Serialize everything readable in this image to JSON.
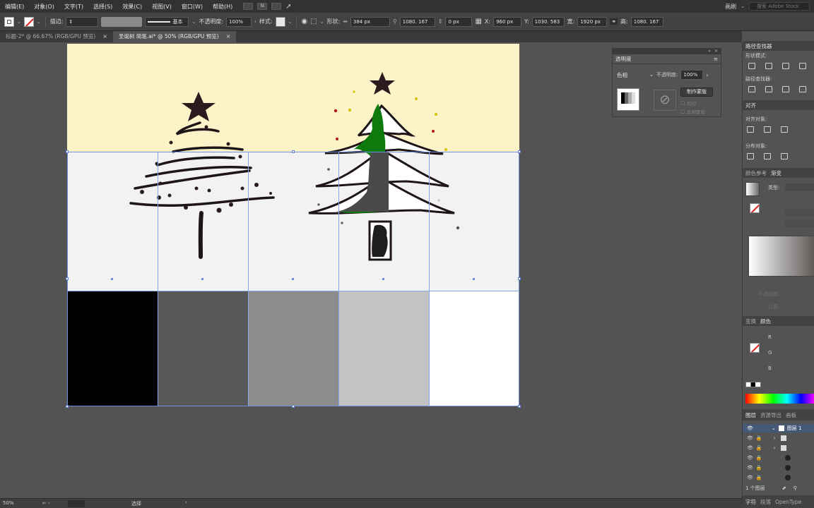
{
  "menu": {
    "items": [
      "编辑(E)",
      "对象(O)",
      "文字(T)",
      "选择(S)",
      "效果(C)",
      "视图(V)",
      "窗口(W)",
      "帮助(H)"
    ],
    "workspace": "画刷",
    "search_placeholder": "搜索 Adobe Stock"
  },
  "control": {
    "stroke_label": "描边:",
    "stroke_profile": "基本",
    "opacity_label": "不透明度:",
    "opacity_value": "100%",
    "style_label": "样式:",
    "shape_label": "形状:",
    "shape_w": "384 px",
    "shape_h": "1080. 167",
    "radius": "0 px",
    "x_label": "X:",
    "x_value": "960 px",
    "y_label": "Y:",
    "y_value": "1030. 583",
    "w_label": "宽:",
    "w_value": "1920 px",
    "h_label": "高:",
    "h_value": "1080. 167"
  },
  "tabs": [
    {
      "label": "标题-2* @ 66.67% (RGB/GPU 预览)",
      "active": false
    },
    {
      "label": "圣诞树 简笔.ai* @ 50% (RGB/GPU 预览)",
      "active": true
    }
  ],
  "transparency": {
    "title": "透明度",
    "blend_mode": "色相",
    "opacity_label": "不透明度:",
    "opacity_value": "100%",
    "make_mask": "制作蒙版",
    "clip": "剪切",
    "invert": "反相蒙版"
  },
  "dock": {
    "pathfinder_tab": "路径查找器",
    "shape_modes": "形状模式:",
    "pathfinders": "路径查找器:",
    "align_tab": "对齐",
    "align_objects": "对齐对象:",
    "distribute_objects": "分布对象:",
    "color_guide_tab": "颜色参考",
    "gradient_tab": "渐变",
    "type_label": "类型:",
    "opacity_lbl": "不透明度:",
    "location_lbl": "位置:",
    "transform_tab": "变换",
    "color_tab": "颜色",
    "r": "R",
    "g": "G",
    "b": "B",
    "layers_tab": "图层",
    "asset_export_tab": "资源导出",
    "artboards_tab": "画板",
    "layer_name": "图层 1",
    "layer_count": "1 个图层",
    "char_tab": "字符",
    "para_tab": "段落",
    "opentype_tab": "OpenType"
  },
  "statusbar": {
    "zoom": "50%",
    "tool": "选择"
  },
  "colors": {
    "artboard_top": "#fdf3c8",
    "artboard_mid": "#f2f2f2",
    "swatches": [
      "#000000",
      "#585858",
      "#8c8c8c",
      "#c3c3c3",
      "#ffffff"
    ],
    "tree_green": "#0e7a0e"
  }
}
